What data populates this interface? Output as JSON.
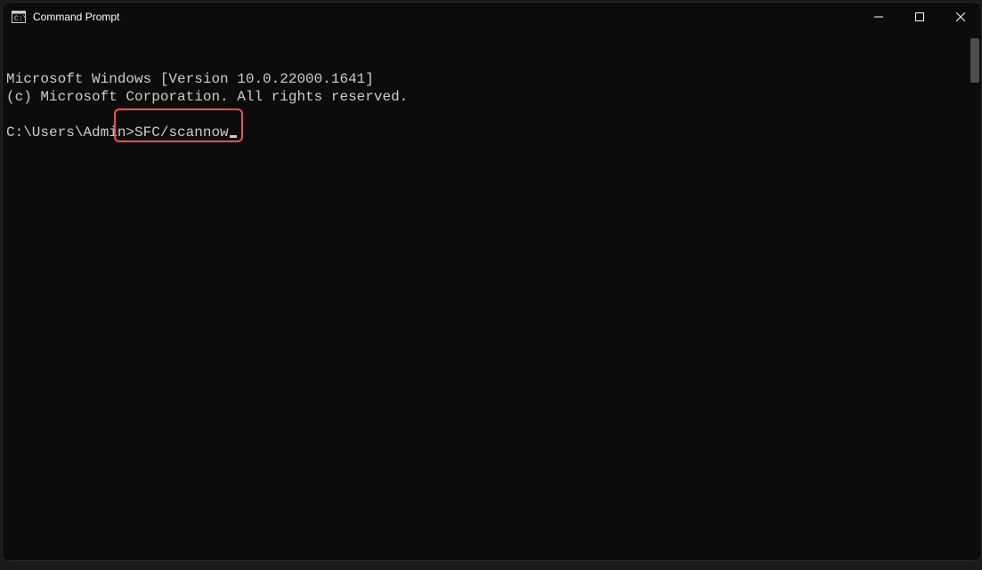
{
  "window": {
    "title": "Command Prompt"
  },
  "terminal": {
    "header_line1": "Microsoft Windows [Version 10.0.22000.1641]",
    "header_line2": "(c) Microsoft Corporation. All rights reserved.",
    "prompt": "C:\\Users\\Admin>",
    "command": "SFC/scannow"
  }
}
